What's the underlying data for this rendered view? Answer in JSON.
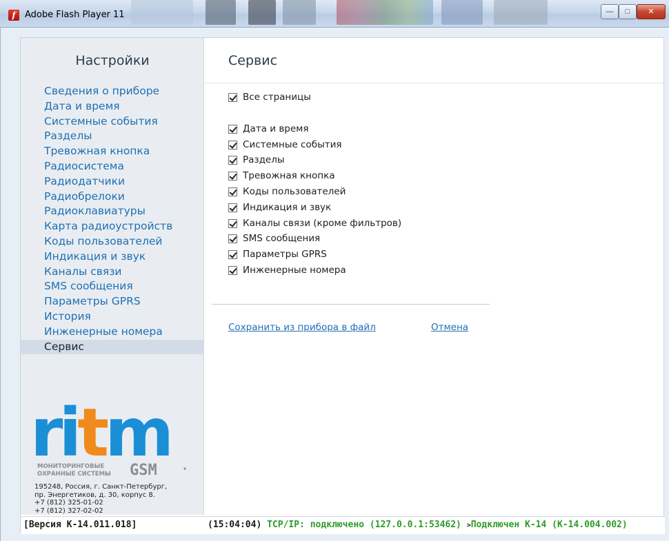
{
  "window": {
    "title": "Adobe Flash Player 11",
    "controls": {
      "minimize": "—",
      "maximize": "□",
      "close": "✕"
    }
  },
  "sidebar": {
    "title": "Настройки",
    "items": [
      {
        "label": "Сведения о приборе"
      },
      {
        "label": "Дата и время"
      },
      {
        "label": "Системные события"
      },
      {
        "label": "Разделы"
      },
      {
        "label": "Тревожная кнопка"
      },
      {
        "label": "Радиосистема"
      },
      {
        "label": "Радиодатчики"
      },
      {
        "label": "Радиобрелоки"
      },
      {
        "label": "Радиоклавиатуры"
      },
      {
        "label": "Карта радиоустройств"
      },
      {
        "label": "Коды пользователей"
      },
      {
        "label": "Индикация и звук"
      },
      {
        "label": "Каналы связи"
      },
      {
        "label": "SMS сообщения"
      },
      {
        "label": "Параметры GPRS"
      },
      {
        "label": "История"
      },
      {
        "label": "Инженерные номера"
      },
      {
        "label": "Сервис"
      }
    ],
    "active_item": "Сервис",
    "logo": {
      "wordmark": "ritm",
      "caption_line1": "МОНИТОРИНГОВЫЕ",
      "caption_line2": "ОХРАННЫЕ СИСТЕМЫ",
      "gsm": "GSM",
      "colors": {
        "blue": "#1a8fd6",
        "orange": "#f08a1c",
        "gray": "#8a8f96"
      }
    },
    "address": {
      "line1": "195248, Россия, г. Санкт-Петербург,",
      "line2": "пр. Энергетиков, д. 30, корпус 8.",
      "line3": "+7 (812) 325-01-02",
      "line4": "+7 (812) 327-02-02"
    }
  },
  "main": {
    "title": "Сервис",
    "all_pages": {
      "label": "Все страницы",
      "checked": true
    },
    "pages": [
      {
        "label": "Дата и время",
        "checked": true
      },
      {
        "label": "Системные события",
        "checked": true
      },
      {
        "label": "Разделы",
        "checked": true
      },
      {
        "label": "Тревожная кнопка",
        "checked": true
      },
      {
        "label": "Коды пользователей",
        "checked": true
      },
      {
        "label": "Индикация и звук",
        "checked": true
      },
      {
        "label": "Каналы связи (кроме фильтров)",
        "checked": true
      },
      {
        "label": "SMS сообщения",
        "checked": true
      },
      {
        "label": "Параметры GPRS",
        "checked": true
      },
      {
        "label": "Инженерные номера",
        "checked": true
      }
    ],
    "save_link": "Сохранить из прибора в файл",
    "cancel_link": "Отмена"
  },
  "status": {
    "version": "[Версия К-14.011.018]",
    "time": "(15:04:04)",
    "connection": "TCP/IP: подключено (127.0.0.1:53462)",
    "arrow": ">",
    "device": "Подключен К-14 (К-14.004.002)",
    "colors": {
      "ok": "#2e9b2a",
      "default": "#1b1b1b"
    }
  }
}
